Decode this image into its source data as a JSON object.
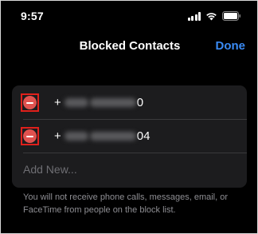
{
  "status_bar": {
    "time": "9:57",
    "icons": [
      "cellular-signal-icon",
      "wifi-icon",
      "battery-icon"
    ]
  },
  "nav": {
    "title": "Blocked Contacts",
    "done_label": "Done"
  },
  "blocked_list": {
    "items": [
      {
        "prefix": "+",
        "suffix": "0"
      },
      {
        "prefix": "+",
        "suffix": "04"
      }
    ],
    "add_new_label": "Add New..."
  },
  "footer": {
    "note": "You will not receive phone calls, messages, email, or FaceTime from people on the block list."
  },
  "colors": {
    "background": "#000000",
    "card": "#1c1c1e",
    "accent": "#3a8bf5",
    "destructive": "#e0524f",
    "highlight_box": "#e0201b",
    "secondary_text": "#8e8e93"
  }
}
